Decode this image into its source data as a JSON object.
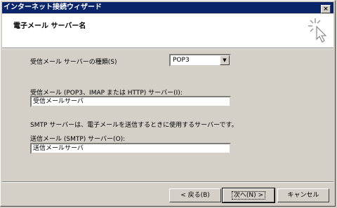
{
  "window": {
    "title": "インターネット接続ウィザード",
    "close_label": "×"
  },
  "header": {
    "title": "電子メール サーバー名",
    "icon": "wizard-sparkle-cursor-icon"
  },
  "form": {
    "server_type_label": "受信メール サーバーの種類(S)",
    "server_type_value": "POP3",
    "incoming_label": "受信メール (POP3、IMAP または HTTP) サーバー(I):",
    "incoming_value": "受信メールサーバ",
    "smtp_note": "SMTP サーバーは、電子メールを送信するときに使用するサーバーです。",
    "outgoing_label": "送信メール (SMTP) サーバー(O):",
    "outgoing_value": "送信メールサーバ"
  },
  "buttons": {
    "back": "< 戻る(B)",
    "next": "次へ(N) >",
    "cancel": "キャンセル"
  }
}
